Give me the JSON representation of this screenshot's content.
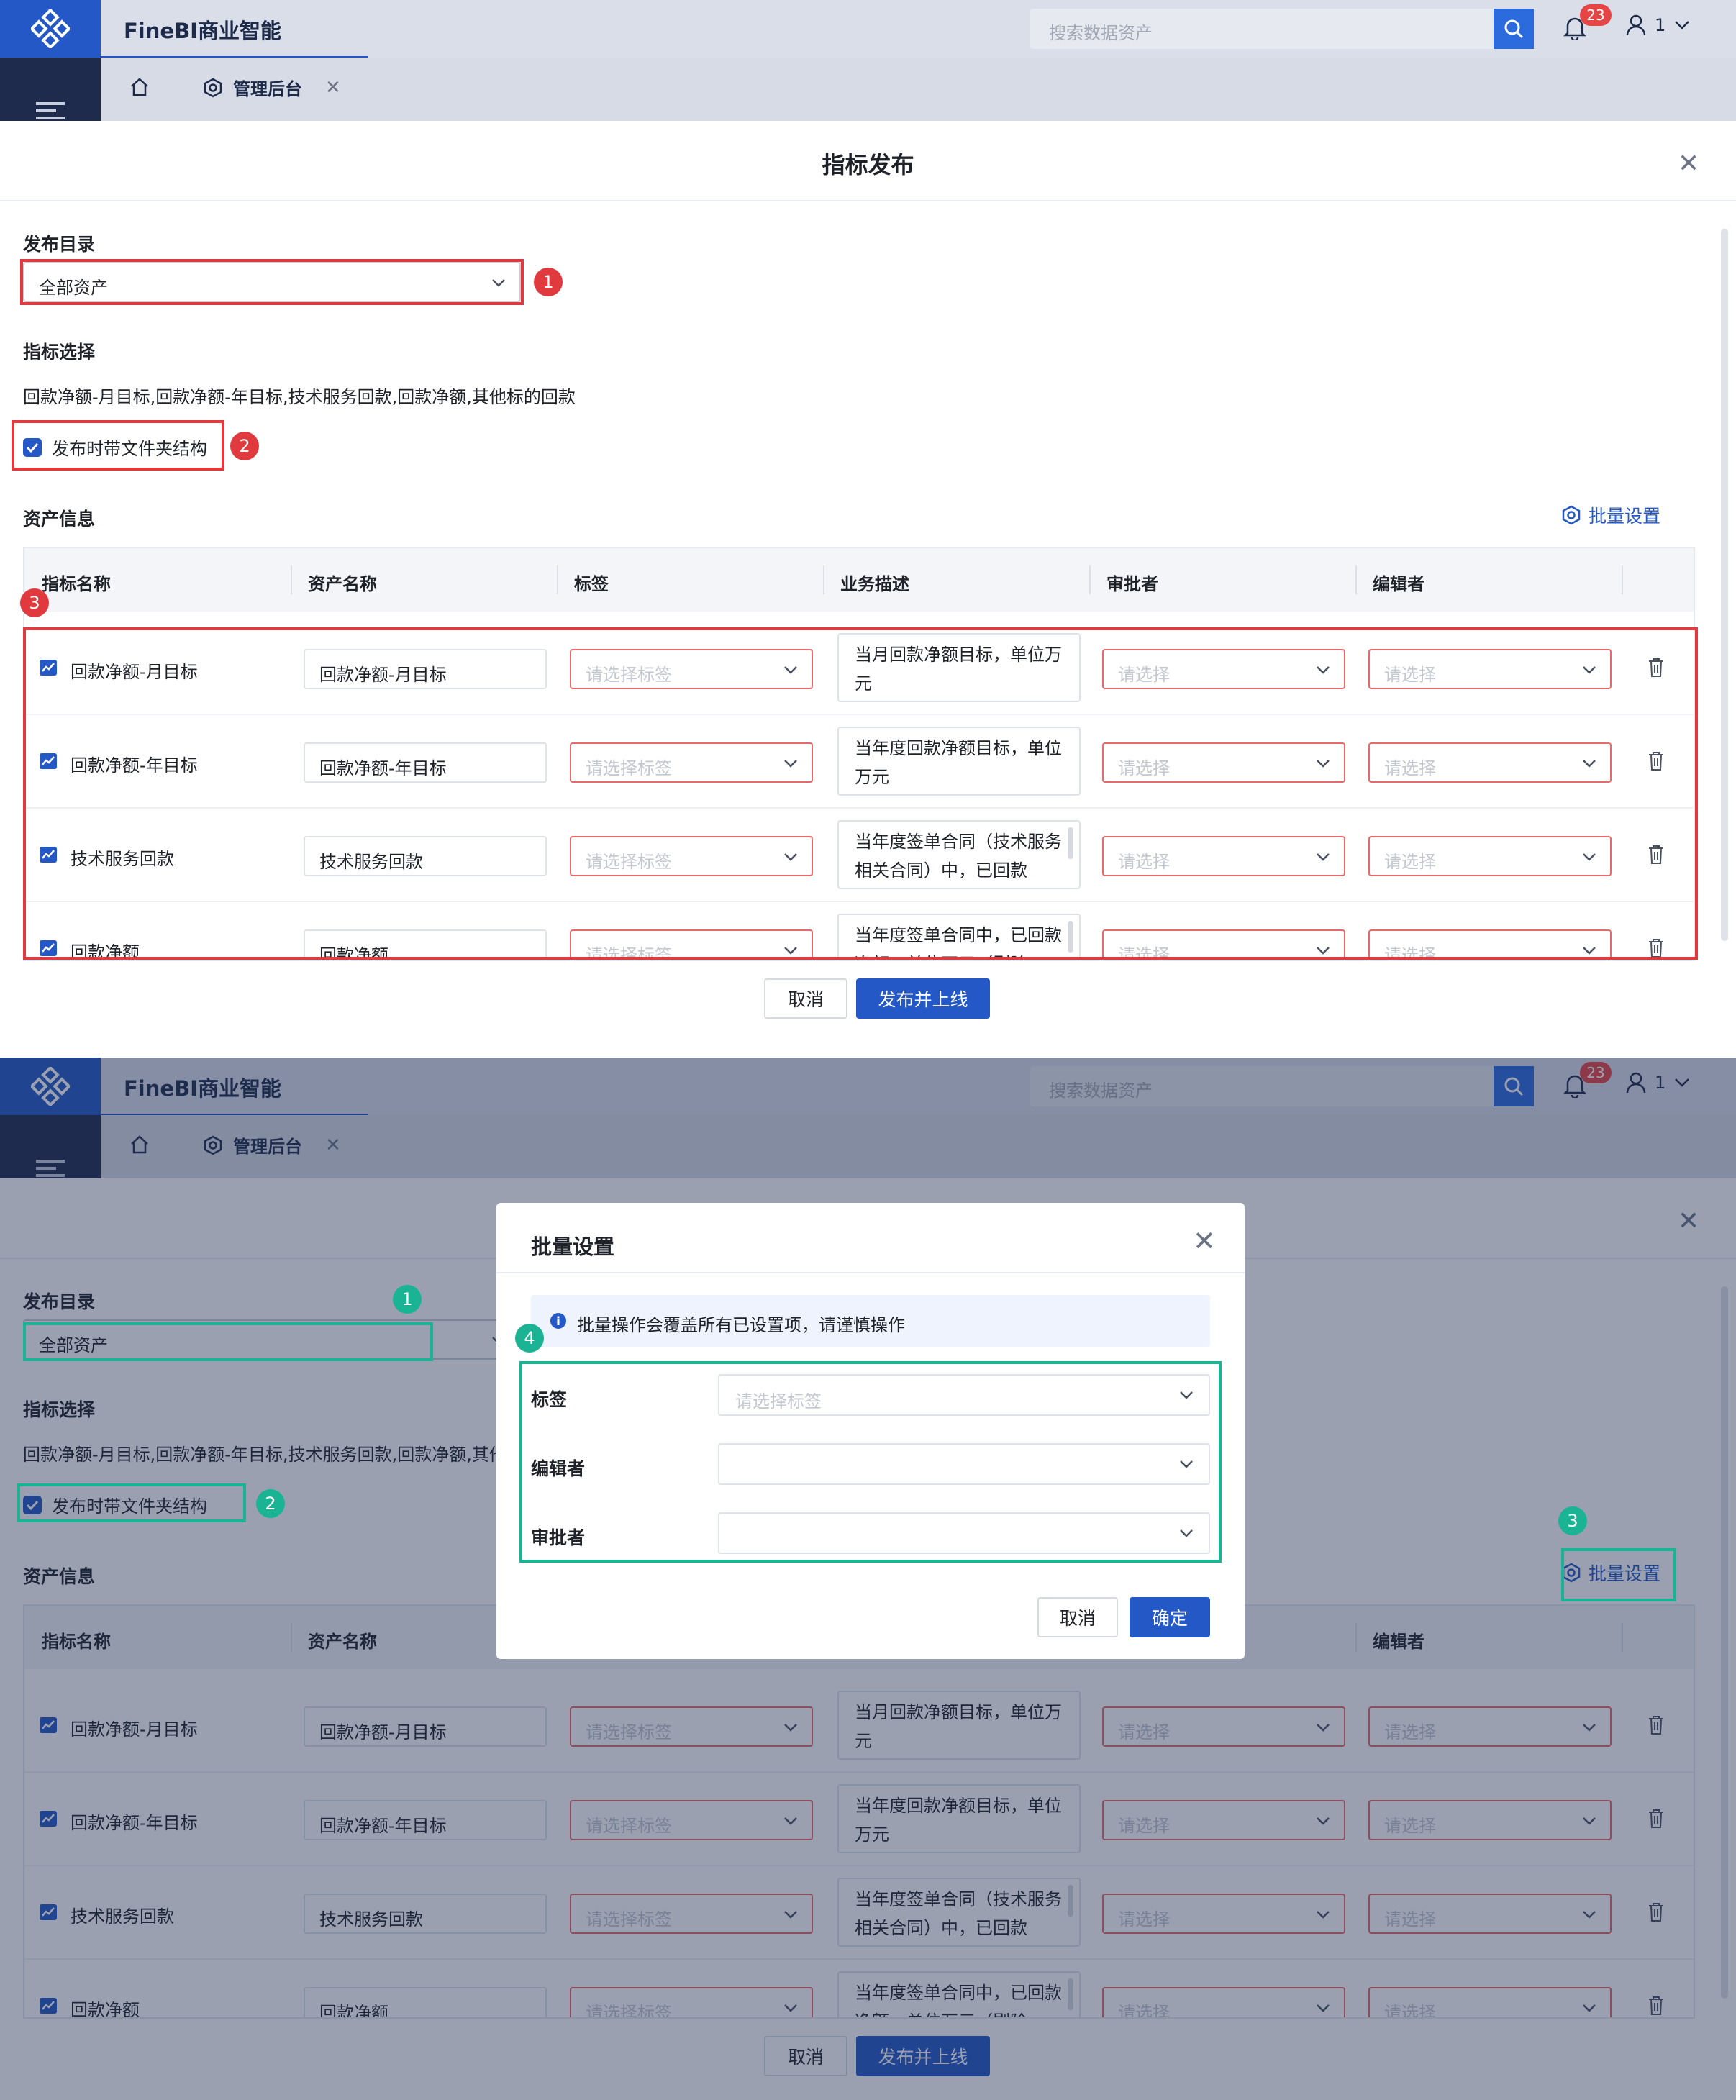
{
  "app": {
    "brand": "FineBI商业智能",
    "search_placeholder": "搜索数据资产",
    "badge_count": "23",
    "user_name": "1",
    "admin_tab": "管理后台"
  },
  "drawer": {
    "title": "指标发布",
    "dir_label": "发布目录",
    "dir_value": "全部资产",
    "ind_label": "指标选择",
    "ind_text": "回款净额-月目标,回款净额-年目标,技术服务回款,回款净额,其他标的回款",
    "folder_label": "发布时带文件夹结构",
    "asset_label": "资产信息",
    "batch_label": "批量设置",
    "columns": [
      "指标名称",
      "资产名称",
      "标签",
      "业务描述",
      "审批者",
      "编辑者"
    ],
    "tag_placeholder": "请选择标签",
    "select_placeholder": "请选择",
    "rows": [
      {
        "name": "回款净额-月目标",
        "asset": "回款净额-月目标",
        "desc": "当月回款净额目标，单位万元"
      },
      {
        "name": "回款净额-年目标",
        "asset": "回款净额-年目标",
        "desc": "当年度回款净额目标，单位万元"
      },
      {
        "name": "技术服务回款",
        "asset": "技术服务回款",
        "desc": "当年度签单合同（技术服务相关合同）中，已回款"
      },
      {
        "name": "回款净额",
        "asset": "回款净额",
        "desc": "当年度签单合同中，已回款净额，单位万元（剔除"
      }
    ],
    "cancel_label": "取消",
    "publish_label": "发布并上线"
  },
  "modal": {
    "title": "批量设置",
    "info": "批量操作会覆盖所有已设置项，请谨慎操作",
    "tag_label": "标签",
    "tag_placeholder": "请选择标签",
    "editor_label": "编辑者",
    "approver_label": "审批者",
    "cancel_label": "取消",
    "confirm_label": "确定"
  },
  "annotations": {
    "top": [
      "1",
      "2",
      "3"
    ],
    "bottom": [
      "1",
      "2",
      "3",
      "4"
    ]
  },
  "colors": {
    "brand_blue": "#2458c7",
    "annotation_red": "#e0393e",
    "annotation_green": "#1ab394"
  }
}
